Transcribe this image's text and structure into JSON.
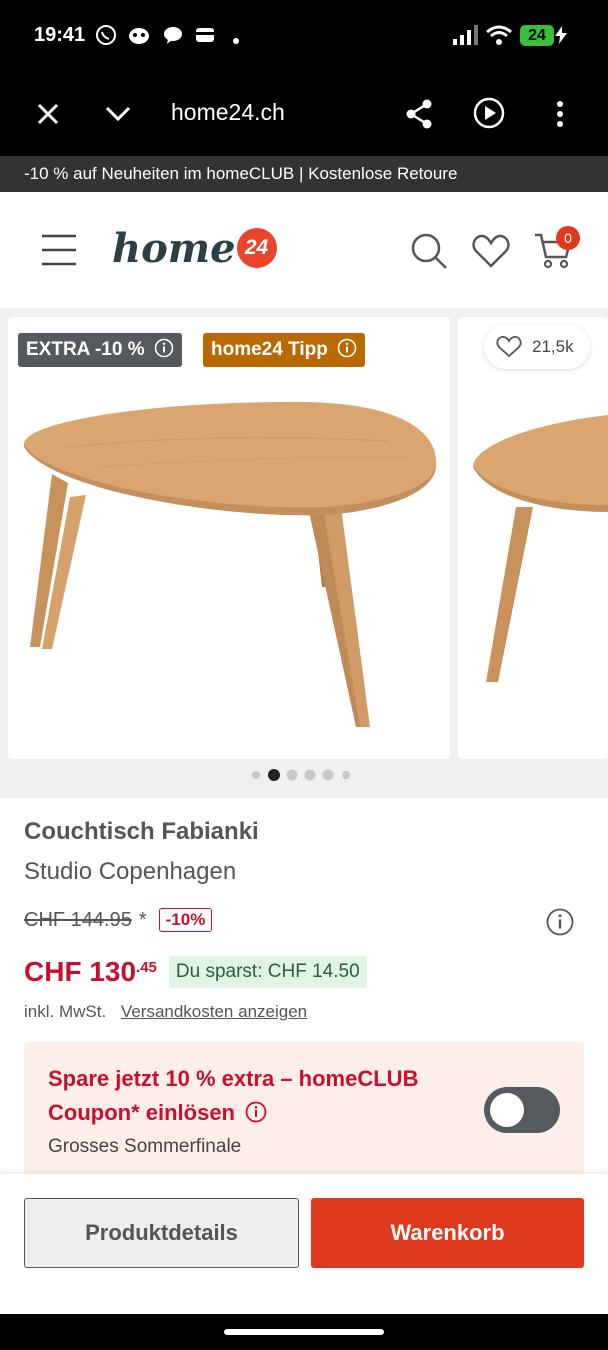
{
  "status": {
    "time": "19:41",
    "battery": "24"
  },
  "browser": {
    "url": "home24.ch"
  },
  "promo": {
    "text": "-10 % auf Neuheiten im homeCLUB | Kostenlose Retoure"
  },
  "header": {
    "logo_text": "home",
    "logo_badge": "24",
    "cart_count": "0"
  },
  "gallery": {
    "badge_extra": "EXTRA -10 %",
    "badge_tipp": "home24 Tipp",
    "wishlist_count": "21,5k",
    "dots_total": 6,
    "dots_active": 1
  },
  "product": {
    "title": "Couchtisch Fabianki",
    "brand": "Studio Copenhagen",
    "old_price": "CHF 144.95",
    "old_price_mark": "*",
    "discount": "-10%",
    "price_main": "CHF 130",
    "price_cents": ".45",
    "savings": "Du sparst: CHF 14.50",
    "tax_note": "inkl. MwSt.",
    "shipping_link": "Versandkosten anzeigen"
  },
  "coupon": {
    "line1": "Spare jetzt 10 % extra – homeCLUB",
    "line2": "Coupon* einlösen",
    "subtitle": "Grosses Sommerfinale",
    "toggle_on": false
  },
  "actions": {
    "details_label": "Produktdetails",
    "cart_label": "Warenkorb"
  },
  "colors": {
    "accent": "#e03a1e",
    "price_red": "#c8102e",
    "tipp_orange": "#b86a00",
    "badge_gray": "#555a5e"
  }
}
